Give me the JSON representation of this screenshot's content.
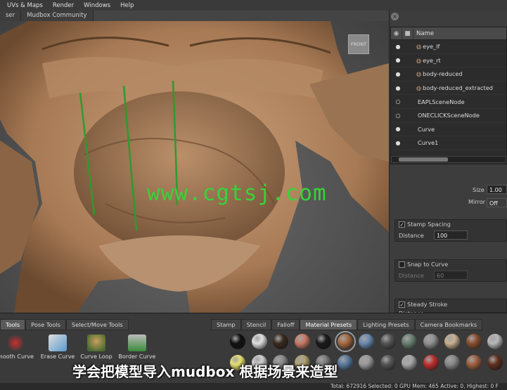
{
  "menubar": {
    "items": [
      "UVs & Maps",
      "Render",
      "Windows",
      "Help"
    ]
  },
  "viewport_tabs": [
    "ser",
    "Mudbox Community"
  ],
  "viewport": {
    "view_cube_label": "FRONT",
    "watermark": "www.cgtsj.com"
  },
  "outliner": {
    "name_header": "Name",
    "rows": [
      {
        "name": "eye_lf",
        "mesh": true
      },
      {
        "name": "eye_rt",
        "mesh": true
      },
      {
        "name": "body-reduced",
        "mesh": true
      },
      {
        "name": "body-reduced_extracted",
        "mesh": true
      },
      {
        "name": "EAPLSceneNode",
        "mesh": false
      },
      {
        "name": "ONECLICKSceneNode",
        "mesh": false
      },
      {
        "name": "Curve",
        "mesh": false
      },
      {
        "name": "Curve1",
        "mesh": false
      }
    ]
  },
  "properties": {
    "size_label": "Size",
    "size_value": "1.00",
    "mirror_label": "Mirror",
    "mirror_value": "Off",
    "stamp_spacing_label": "Stamp Spacing",
    "stamp_spacing_checked": true,
    "distance_label": "Distance",
    "distance_value": "100",
    "snap_to_curve_label": "Snap to Curve",
    "snap_to_curve_checked": false,
    "snap_distance_label": "Distance",
    "snap_distance_value": "60",
    "steady_stroke_label": "Steady Stroke",
    "steady_stroke_checked": true,
    "steady_distance_label": "Distance"
  },
  "tool_tabs": [
    "Tools",
    "Pose Tools",
    "Select/Move Tools"
  ],
  "tools": [
    "mooth Curve",
    "Erase Curve",
    "Curve Loop",
    "Border Curve"
  ],
  "tray_tabs": [
    "Stamp",
    "Stencil",
    "Falloff",
    "Material Presets",
    "Lighting Presets",
    "Camera Bookmarks"
  ],
  "tray_selected": "Material Presets",
  "subtitle": "学会把模型导入mudbox 根据场景来造型",
  "status": "Total: 672916  Selected: 0  GPU Mem: 465  Active: 0, Highest: 0  F",
  "colors": {
    "swatches_row1": [
      "#111111",
      "#e0e0e0",
      "#3a2a1e",
      "#c87a68",
      "#1a1a1a",
      "#a86a40",
      "#6a8ab0",
      "#555555",
      "#6a8070",
      "#909090",
      "#c8b090",
      "#8a5030",
      "#b8b8b8",
      "#bfa080"
    ],
    "swatches_row2": [
      "#e8e070",
      "#d0d0d0",
      "#888888",
      "#b0a070",
      "#7a7a7a",
      "#5a7aa0",
      "#9a9a9a",
      "#555555",
      "#a8a8a8",
      "#c03030",
      "#888888",
      "#a06040",
      "#603020",
      "#d0a080"
    ]
  }
}
